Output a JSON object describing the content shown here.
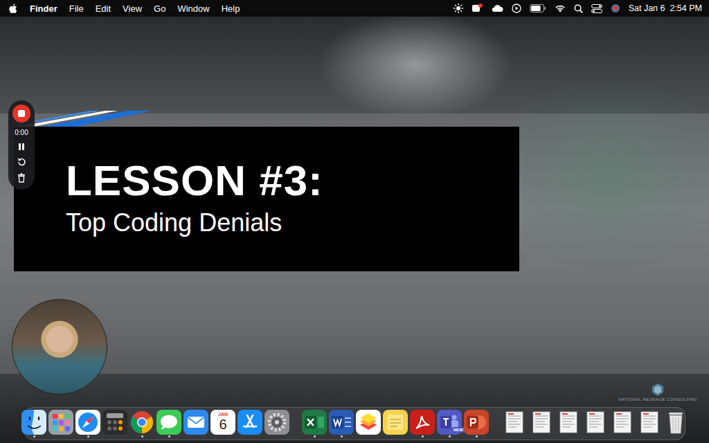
{
  "menu_bar": {
    "menus": [
      {
        "label": "Finder",
        "selected": true
      },
      {
        "label": "File",
        "selected": false
      },
      {
        "label": "Edit",
        "selected": false
      },
      {
        "label": "View",
        "selected": false
      },
      {
        "label": "Go",
        "selected": false
      },
      {
        "label": "Window",
        "selected": false
      },
      {
        "label": "Help",
        "selected": false
      }
    ],
    "battery": {
      "level": 0.8
    },
    "clock": "Sat Jan 6  2:54 PM"
  },
  "recorder": {
    "time": "0:00",
    "recording": true
  },
  "slide": {
    "title": "LESSON #3:",
    "subtitle": "Top Coding Denials",
    "logo_text": "NATIONAL REVENUE CONSULTING"
  },
  "dock": {
    "groups": [
      [
        {
          "kind": "finder",
          "running": true
        },
        {
          "kind": "launchpad",
          "running": false
        },
        {
          "kind": "safari",
          "running": true
        },
        {
          "kind": "calculator",
          "running": false
        },
        {
          "kind": "chrome",
          "running": true
        },
        {
          "kind": "messages",
          "running": true
        },
        {
          "kind": "mail",
          "running": false
        },
        {
          "kind": "calendar",
          "running": false,
          "month": "JAN",
          "day": "6"
        },
        {
          "kind": "appstore",
          "running": false
        },
        {
          "kind": "settings",
          "running": false
        }
      ],
      [
        {
          "kind": "excel",
          "running": true
        },
        {
          "kind": "word",
          "running": true
        },
        {
          "kind": "layers",
          "running": false
        },
        {
          "kind": "stickies",
          "running": false
        },
        {
          "kind": "acrobat",
          "running": true
        },
        {
          "kind": "teams",
          "running": true,
          "badge": "NEW"
        },
        {
          "kind": "powerpoint",
          "running": true
        }
      ],
      [
        {
          "kind": "document",
          "running": false
        },
        {
          "kind": "document",
          "running": false
        },
        {
          "kind": "document",
          "running": false
        },
        {
          "kind": "document",
          "running": false
        },
        {
          "kind": "document",
          "running": false
        },
        {
          "kind": "document",
          "running": false
        },
        {
          "kind": "trash",
          "running": false
        }
      ]
    ]
  }
}
